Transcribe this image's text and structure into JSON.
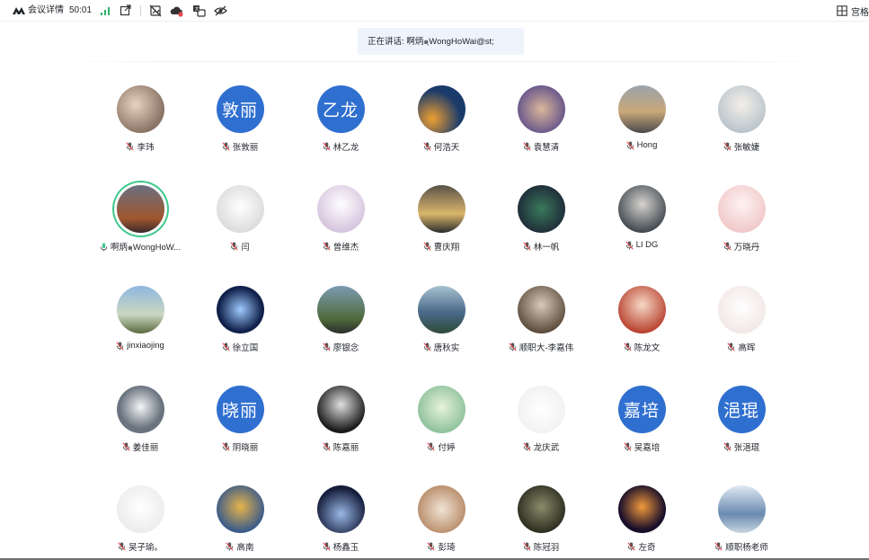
{
  "topbar": {
    "meeting_details": "会议详情",
    "timer": "50:01",
    "view_mode": "宫格"
  },
  "speaker_banner": {
    "text": "正在讲话: 啊炳๑ฺWongHoWai@st;"
  },
  "colors": {
    "accent_blue": "#2f6fd0",
    "speaking_green": "#3ec98c",
    "mic_muted_red": "#e5484d",
    "banner_bg": "#eef3fc"
  },
  "participants": [
    {
      "name": "李玮",
      "avatar_text": "",
      "muted": true
    },
    {
      "name": "张敦丽",
      "avatar_text": "敦丽",
      "muted": true
    },
    {
      "name": "林乙龙",
      "avatar_text": "乙龙",
      "muted": true
    },
    {
      "name": "何浩天",
      "avatar_text": "",
      "muted": true
    },
    {
      "name": "袁慧清",
      "avatar_text": "",
      "muted": true
    },
    {
      "name": "Hong",
      "avatar_text": "",
      "muted": true
    },
    {
      "name": "张敏婕",
      "avatar_text": "",
      "muted": true
    },
    {
      "name": "啊炳๑ฺWongHoW...",
      "avatar_text": "",
      "muted": false,
      "speaking": true
    },
    {
      "name": "闫",
      "avatar_text": "",
      "muted": true
    },
    {
      "name": "曾维杰",
      "avatar_text": "",
      "muted": true
    },
    {
      "name": "曹庆翔",
      "avatar_text": "",
      "muted": true
    },
    {
      "name": "林一帆",
      "avatar_text": "",
      "muted": true
    },
    {
      "name": "LI DG",
      "avatar_text": "",
      "muted": true
    },
    {
      "name": "万晓丹",
      "avatar_text": "",
      "muted": true
    },
    {
      "name": "jinxiaojing",
      "avatar_text": "",
      "muted": true
    },
    {
      "name": "徐立国",
      "avatar_text": "",
      "muted": true
    },
    {
      "name": "廖银念",
      "avatar_text": "",
      "muted": true
    },
    {
      "name": "唐秋实",
      "avatar_text": "",
      "muted": true
    },
    {
      "name": "顺职大-李嘉伟",
      "avatar_text": "",
      "muted": true
    },
    {
      "name": "陈龙文",
      "avatar_text": "",
      "muted": true
    },
    {
      "name": "高晖",
      "avatar_text": "",
      "muted": true
    },
    {
      "name": "姜佳丽",
      "avatar_text": "",
      "muted": true
    },
    {
      "name": "阴晓丽",
      "avatar_text": "晓丽",
      "muted": true
    },
    {
      "name": "陈嘉丽",
      "avatar_text": "",
      "muted": true
    },
    {
      "name": "付婷",
      "avatar_text": "",
      "muted": true
    },
    {
      "name": "龙庆武",
      "avatar_text": "",
      "muted": true
    },
    {
      "name": "吴嘉培",
      "avatar_text": "嘉培",
      "muted": true
    },
    {
      "name": "张浥琨",
      "avatar_text": "浥琨",
      "muted": true
    },
    {
      "name": "吴子瑜。",
      "avatar_text": "",
      "muted": true
    },
    {
      "name": "高南",
      "avatar_text": "",
      "muted": true
    },
    {
      "name": "杨鑫玉",
      "avatar_text": "",
      "muted": true
    },
    {
      "name": "彭琦",
      "avatar_text": "",
      "muted": true
    },
    {
      "name": "陈冠羽",
      "avatar_text": "",
      "muted": true
    },
    {
      "name": "左奇",
      "avatar_text": "",
      "muted": true
    },
    {
      "name": "顺职杨老师",
      "avatar_text": "",
      "muted": true
    }
  ]
}
